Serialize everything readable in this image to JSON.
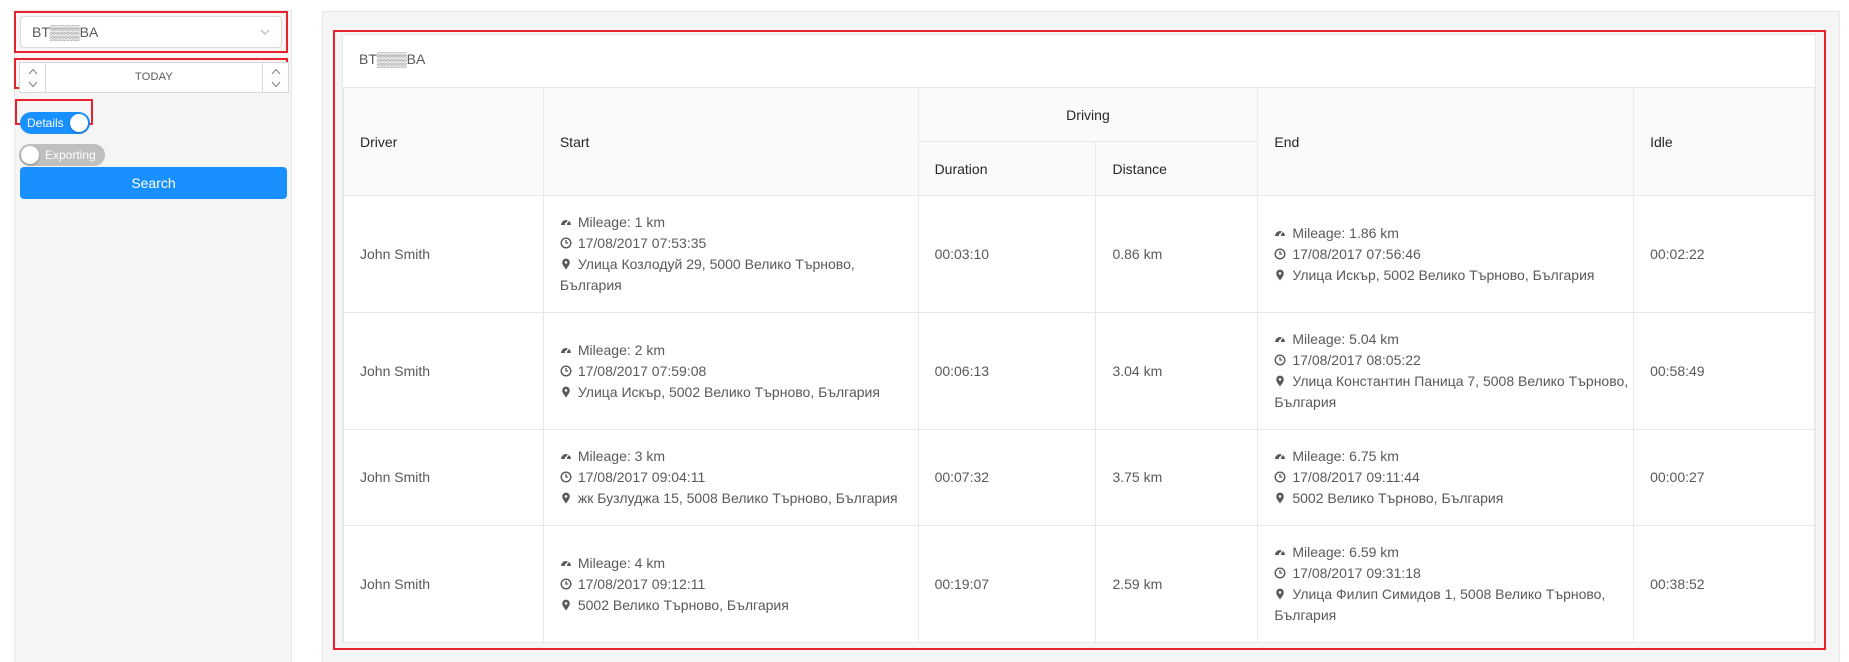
{
  "sidebar": {
    "vehicle": "BT▒▒▒BA",
    "date_label": "TODAY",
    "details_toggle": "Details",
    "exporting_toggle": "Exporting",
    "search_button": "Search"
  },
  "report": {
    "title": "BT▒▒▒BA",
    "headers": {
      "driver": "Driver",
      "start": "Start",
      "driving": "Driving",
      "duration": "Duration",
      "distance": "Distance",
      "end": "End",
      "idle": "Idle"
    },
    "rows": [
      {
        "driver": "John Smith",
        "start_mileage": "Mileage: 1 km",
        "start_time": "17/08/2017 07:53:35",
        "start_address": "Улица Козлодуй 29, 5000 Велико Търново, България",
        "duration": "00:03:10",
        "distance": "0.86 km",
        "end_mileage": "Mileage: 1.86 km",
        "end_time": "17/08/2017 07:56:46",
        "end_address": "Улица Искър, 5002 Велико Търново, България",
        "idle": "00:02:22"
      },
      {
        "driver": "John Smith",
        "start_mileage": "Mileage: 2 km",
        "start_time": "17/08/2017 07:59:08",
        "start_address": "Улица Искър, 5002 Велико Търново, България",
        "duration": "00:06:13",
        "distance": "3.04 km",
        "end_mileage": "Mileage: 5.04 km",
        "end_time": "17/08/2017 08:05:22",
        "end_address": "Улица Константин Паница 7, 5008 Велико Търново, България",
        "idle": "00:58:49"
      },
      {
        "driver": "John Smith",
        "start_mileage": "Mileage: 3 km",
        "start_time": "17/08/2017 09:04:11",
        "start_address": "жк Бузлуджа 15, 5008 Велико Търново, България",
        "duration": "00:07:32",
        "distance": "3.75 km",
        "end_mileage": "Mileage: 6.75 km",
        "end_time": "17/08/2017 09:11:44",
        "end_address": "5002 Велико Търново, България",
        "idle": "00:00:27"
      },
      {
        "driver": "John Smith",
        "start_mileage": "Mileage: 4 km",
        "start_time": "17/08/2017 09:12:11",
        "start_address": "5002 Велико Търново, България",
        "duration": "00:19:07",
        "distance": "2.59 km",
        "end_mileage": "Mileage: 6.59 km",
        "end_time": "17/08/2017 09:31:18",
        "end_address": "Улица Филип Симидов 1, 5008 Велико Търново, България",
        "idle": "00:38:52"
      }
    ]
  },
  "colors": {
    "primary": "#1890ff",
    "highlight": "#e8222a",
    "toggle_off": "#bfbfbf"
  },
  "icons": {
    "mileage": "dashboard-icon",
    "time": "clock-icon",
    "address": "map-marker-icon"
  }
}
